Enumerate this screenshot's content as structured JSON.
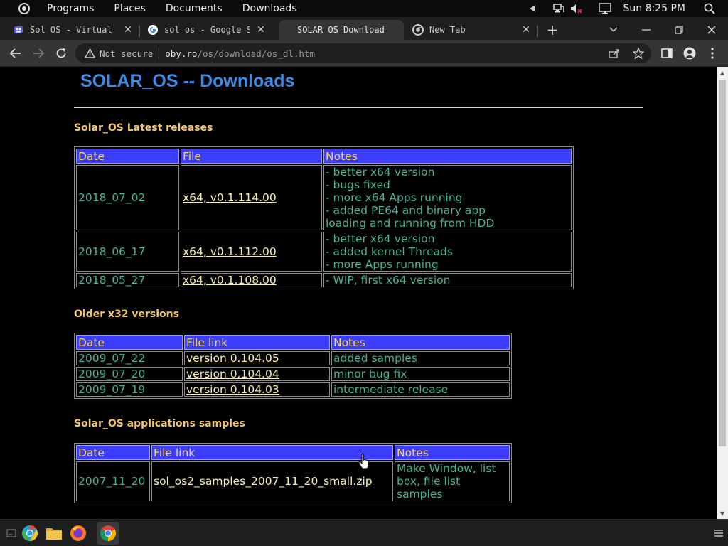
{
  "topbar": {
    "menus": [
      "Programs",
      "Places",
      "Documents",
      "Downloads"
    ],
    "clock": "Sun 8:25 PM"
  },
  "tabs": [
    {
      "title": "Sol OS - Virtual Ma",
      "favicon": "virtualbox-icon"
    },
    {
      "title": "sol os - Google Se",
      "favicon": "google-icon"
    },
    {
      "title": "SOLAR OS Download",
      "favicon": "none",
      "active": true
    },
    {
      "title": "New Tab",
      "favicon": "chrome-icon"
    }
  ],
  "toolbar": {
    "security_label": "Not secure",
    "url_host": "oby.ro",
    "url_path": "/os/download/os_dl.htm"
  },
  "page": {
    "title": "SOLAR_OS -- Downloads",
    "latest": {
      "heading": "Solar_OS Latest releases",
      "headers": [
        "Date",
        "File",
        "Notes"
      ],
      "rows": [
        {
          "date": "2018_07_02",
          "file": "x64, v0.1.114.00",
          "notes": [
            "- better x64 version",
            "- bugs fixed",
            "- more x64 Apps running",
            "- added PE64 and binary app",
            "loading and running from HDD"
          ]
        },
        {
          "date": "2018_06_17",
          "file": "x64, v0.1.112.00",
          "notes": [
            "- better x64 version",
            "- added kernel Threads",
            "- more Apps running"
          ]
        },
        {
          "date": "2018_05_27",
          "file": "x64, v0.1.108.00",
          "notes": [
            "- WIP, first x64 version"
          ]
        }
      ]
    },
    "older": {
      "heading": "Older x32 versions",
      "headers": [
        "Date",
        "File link",
        "Notes"
      ],
      "rows": [
        {
          "date": "2009_07_22",
          "file": "version 0.104.05",
          "notes": [
            "added samples"
          ]
        },
        {
          "date": "2009_07_20",
          "file": "version 0.104.04",
          "notes": [
            "minor bug fix"
          ]
        },
        {
          "date": "2009_07_19",
          "file": "version 0.104.03",
          "notes": [
            "intermediate release"
          ]
        }
      ]
    },
    "samples": {
      "heading": "Solar_OS applications samples",
      "headers": [
        "Date",
        "File link",
        "Notes"
      ],
      "rows": [
        {
          "date": "2007_11_20",
          "file": "sol_os2_samples_2007_11_20_small.zip",
          "notes": [
            "Make Window, list",
            "box, file list",
            "samples"
          ]
        }
      ]
    }
  },
  "colors": {
    "heading": "#3b8ce5",
    "section": "#f2c56a",
    "th_bg": "#3d3dff",
    "th_text": "#f5d94a",
    "cell_text": "#46b398",
    "link": "#f5f0b0"
  }
}
